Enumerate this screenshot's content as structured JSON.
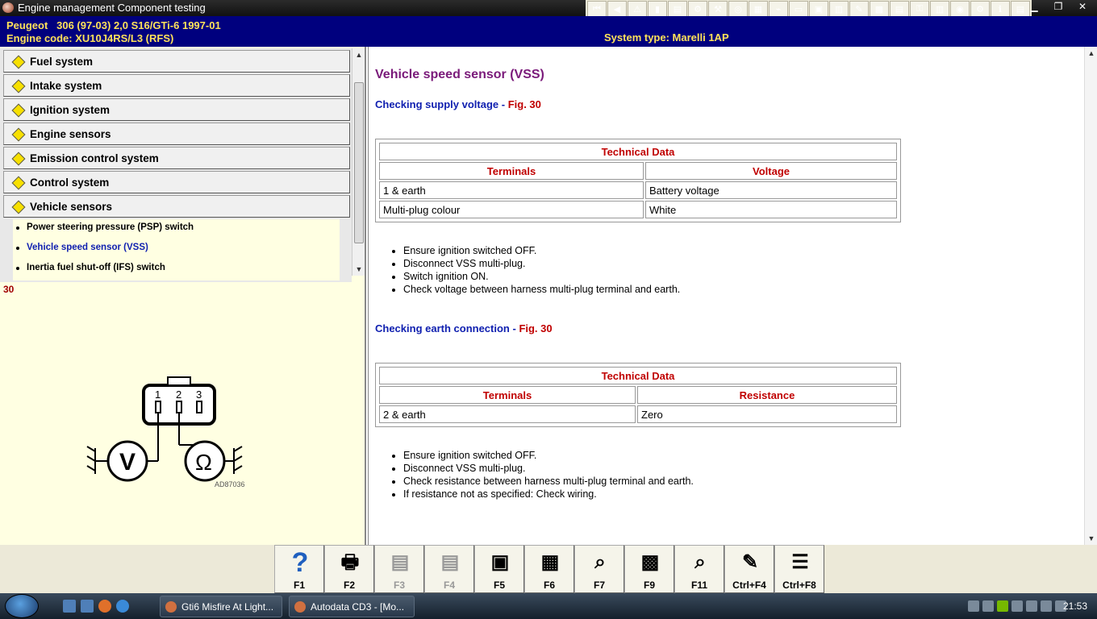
{
  "window": {
    "title": "Engine management Component testing"
  },
  "toolbar_icons": [
    "first-icon",
    "prev-icon",
    "warning-icon",
    "book-icon",
    "service-icon",
    "gear-icon",
    "tools-icon",
    "disc-icon",
    "chart-icon",
    "wiring-icon",
    "battery-icon",
    "engine-icon",
    "car-icon",
    "pen-icon",
    "relay-icon",
    "ecu-icon",
    "key-icon",
    "fuse-icon",
    "tyre-icon",
    "settings-icon",
    "info-icon",
    "notes-icon"
  ],
  "vehicle": {
    "line1": "Peugeot   306 (97-03) 2,0 S16/GTi-6 1997-01",
    "line2": "Engine code: XU10J4RS/L3 (RFS)",
    "system_type": "System type: Marelli 1AP"
  },
  "nav": {
    "items": [
      "Fuel system",
      "Intake system",
      "Ignition system",
      "Engine sensors",
      "Emission control system",
      "Control system",
      "Vehicle sensors"
    ],
    "sub_items": [
      {
        "label": "Power steering pressure (PSP) switch",
        "color": "#000000"
      },
      {
        "label": "Vehicle speed sensor (VSS)",
        "color": "#1020b0"
      },
      {
        "label": "Inertia fuel shut-off (IFS) switch",
        "color": "#000000"
      }
    ]
  },
  "figure": {
    "number": "30",
    "pins": [
      "1",
      "2",
      "3"
    ],
    "meter_v": "V",
    "meter_ohm": "Ω",
    "code": "AD87036"
  },
  "content": {
    "title": "Vehicle speed sensor (VSS)",
    "sec1": {
      "heading": "Checking supply voltage",
      "fig": "Fig. 30",
      "table_title": "Technical Data",
      "col1": "Terminals",
      "col2": "Voltage",
      "rows": [
        [
          "1 & earth",
          "Battery voltage"
        ],
        [
          "Multi-plug colour",
          "White"
        ]
      ],
      "steps": [
        "Ensure ignition switched OFF.",
        "Disconnect VSS multi-plug.",
        "Switch ignition ON.",
        "Check voltage between harness multi-plug terminal and earth."
      ]
    },
    "sec2": {
      "heading": "Checking earth connection",
      "fig": "Fig. 30",
      "table_title": "Technical Data",
      "col1": "Terminals",
      "col2": "Resistance",
      "rows": [
        [
          "2 & earth",
          "Zero"
        ]
      ],
      "steps": [
        "Ensure ignition switched OFF.",
        "Disconnect VSS multi-plug.",
        "Check resistance between harness multi-plug terminal and earth.",
        "If resistance not as specified: Check wiring."
      ]
    }
  },
  "fkeys": [
    {
      "label": "F1",
      "icon": "help-icon",
      "glyph": "?",
      "enabled": true
    },
    {
      "label": "F2",
      "icon": "print-icon",
      "glyph": "🖶",
      "enabled": true
    },
    {
      "label": "F3",
      "icon": "print-preview-icon",
      "glyph": "▤",
      "enabled": false
    },
    {
      "label": "F4",
      "icon": "print-setup-icon",
      "glyph": "▤",
      "enabled": false
    },
    {
      "label": "F5",
      "icon": "component-icon",
      "glyph": "▣",
      "enabled": true
    },
    {
      "label": "F6",
      "icon": "connector-icon",
      "glyph": "▦",
      "enabled": true
    },
    {
      "label": "F7",
      "icon": "zoom-icon",
      "glyph": "⌕",
      "enabled": true
    },
    {
      "label": "F9",
      "icon": "wiring-diagram-icon",
      "glyph": "▩",
      "enabled": true
    },
    {
      "label": "F11",
      "icon": "search-icon",
      "glyph": "⌕",
      "enabled": true
    },
    {
      "label": "Ctrl+F4",
      "icon": "notes-icon",
      "glyph": "✎",
      "enabled": true
    },
    {
      "label": "Ctrl+F8",
      "icon": "list-icon",
      "glyph": "☰",
      "enabled": true
    }
  ],
  "taskbar": {
    "buttons": [
      "Gti6 Misfire At Light...",
      "Autodata CD3 - [Mo..."
    ],
    "clock": "21:53"
  }
}
